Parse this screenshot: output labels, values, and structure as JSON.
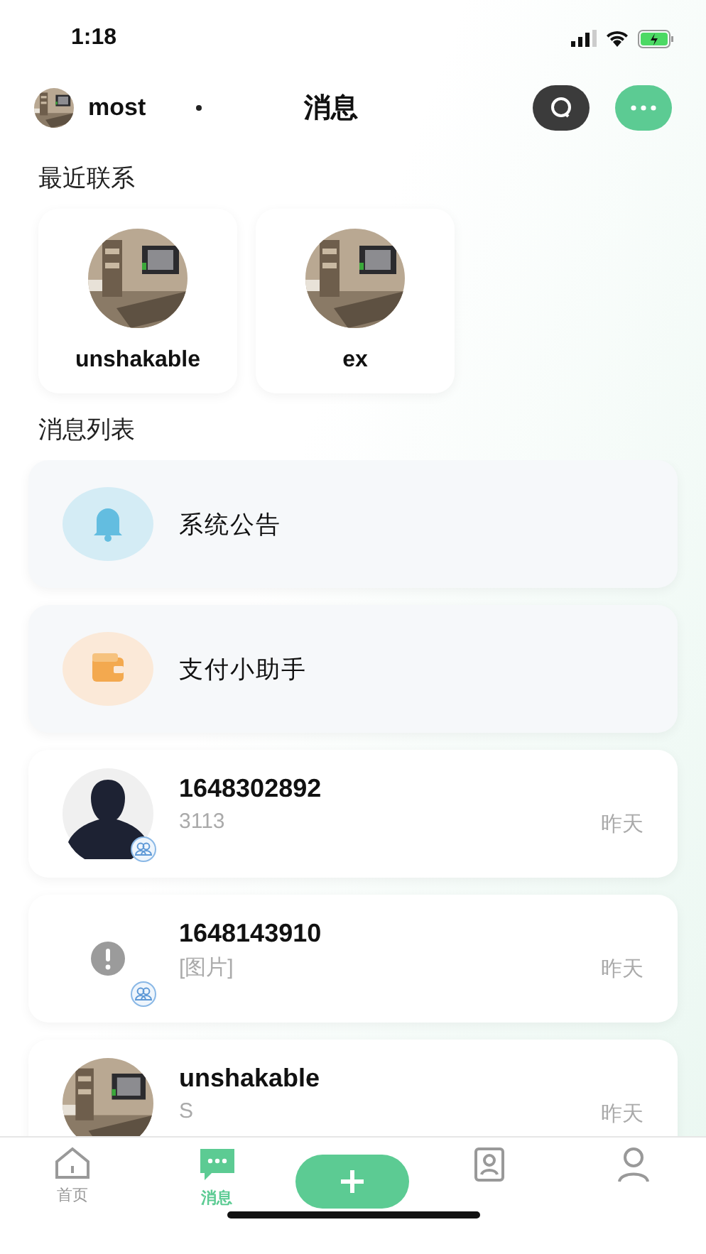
{
  "status_bar": {
    "time": "1:18"
  },
  "header": {
    "user": "most",
    "title": "消息"
  },
  "recent": {
    "title": "最近联系",
    "contacts": [
      {
        "name": "unshakable"
      },
      {
        "name": "ex"
      }
    ]
  },
  "messages": {
    "title": "消息列表",
    "items": [
      {
        "kind": "notice",
        "name": "系统公告"
      },
      {
        "kind": "wallet",
        "name": "支付小助手"
      },
      {
        "kind": "silhouette",
        "name": "1648302892",
        "preview": "3113",
        "time": "昨天",
        "group": true
      },
      {
        "kind": "error",
        "name": "1648143910",
        "preview": "[图片]",
        "time": "昨天",
        "group": true
      },
      {
        "name": "unshakable",
        "preview": "S",
        "time": "昨天",
        "group": false
      }
    ]
  },
  "tabbar": {
    "items": [
      {
        "kind": "home",
        "label": "首页",
        "selected": false
      },
      {
        "kind": "chat",
        "label": "消息",
        "selected": true
      },
      {
        "kind": "add"
      },
      {
        "kind": "contacts",
        "selected": false
      },
      {
        "kind": "profile",
        "selected": false
      }
    ]
  }
}
